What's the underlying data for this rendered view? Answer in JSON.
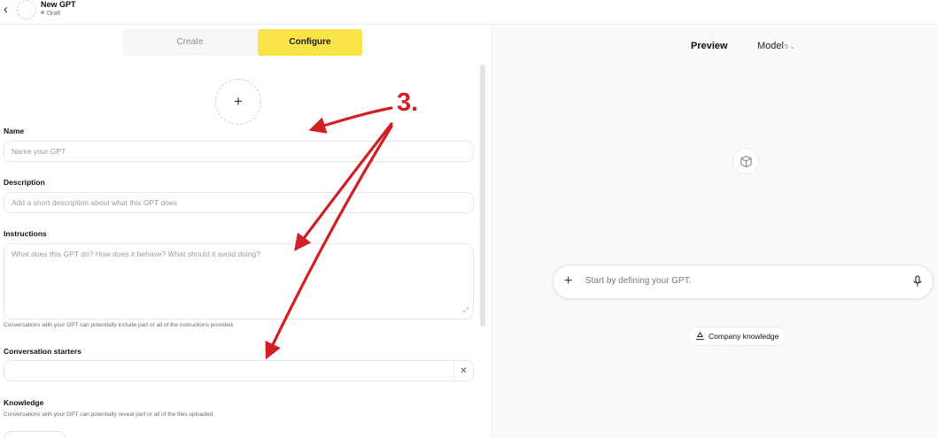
{
  "header": {
    "back_icon": "chevron-left-icon",
    "title": "New GPT",
    "status": "Draft"
  },
  "tabs": [
    {
      "label": "Create",
      "active": false
    },
    {
      "label": "Configure",
      "active": true
    }
  ],
  "form": {
    "upload_icon": "plus-icon",
    "name": {
      "label": "Name",
      "placeholder": "Name your GPT"
    },
    "description": {
      "label": "Description",
      "placeholder": "Add a short description about what this GPT does"
    },
    "instructions": {
      "label": "Instructions",
      "placeholder": "What does this GPT do? How does it behave? What should it avoid doing?",
      "hint": "Conversations with your GPT can potentially include part or all of the instructions provided."
    },
    "conversation_starters": {
      "label": "Conversation starters",
      "value": "",
      "clear_icon": "close-icon"
    },
    "knowledge": {
      "label": "Knowledge",
      "hint": "Conversations with your GPT can potentially reveal part or all of the files uploaded."
    }
  },
  "preview": {
    "title": "Preview",
    "model_label": "Model",
    "model_version": "5",
    "composer_placeholder": "Start by defining your GPT.",
    "knowledge_chip": "Company knowledge"
  },
  "annotation": {
    "step_label": "3.",
    "color": "#d11f26"
  },
  "colors": {
    "accent_tab": "#fbe44a",
    "preview_bg": "#f9f9f9"
  }
}
